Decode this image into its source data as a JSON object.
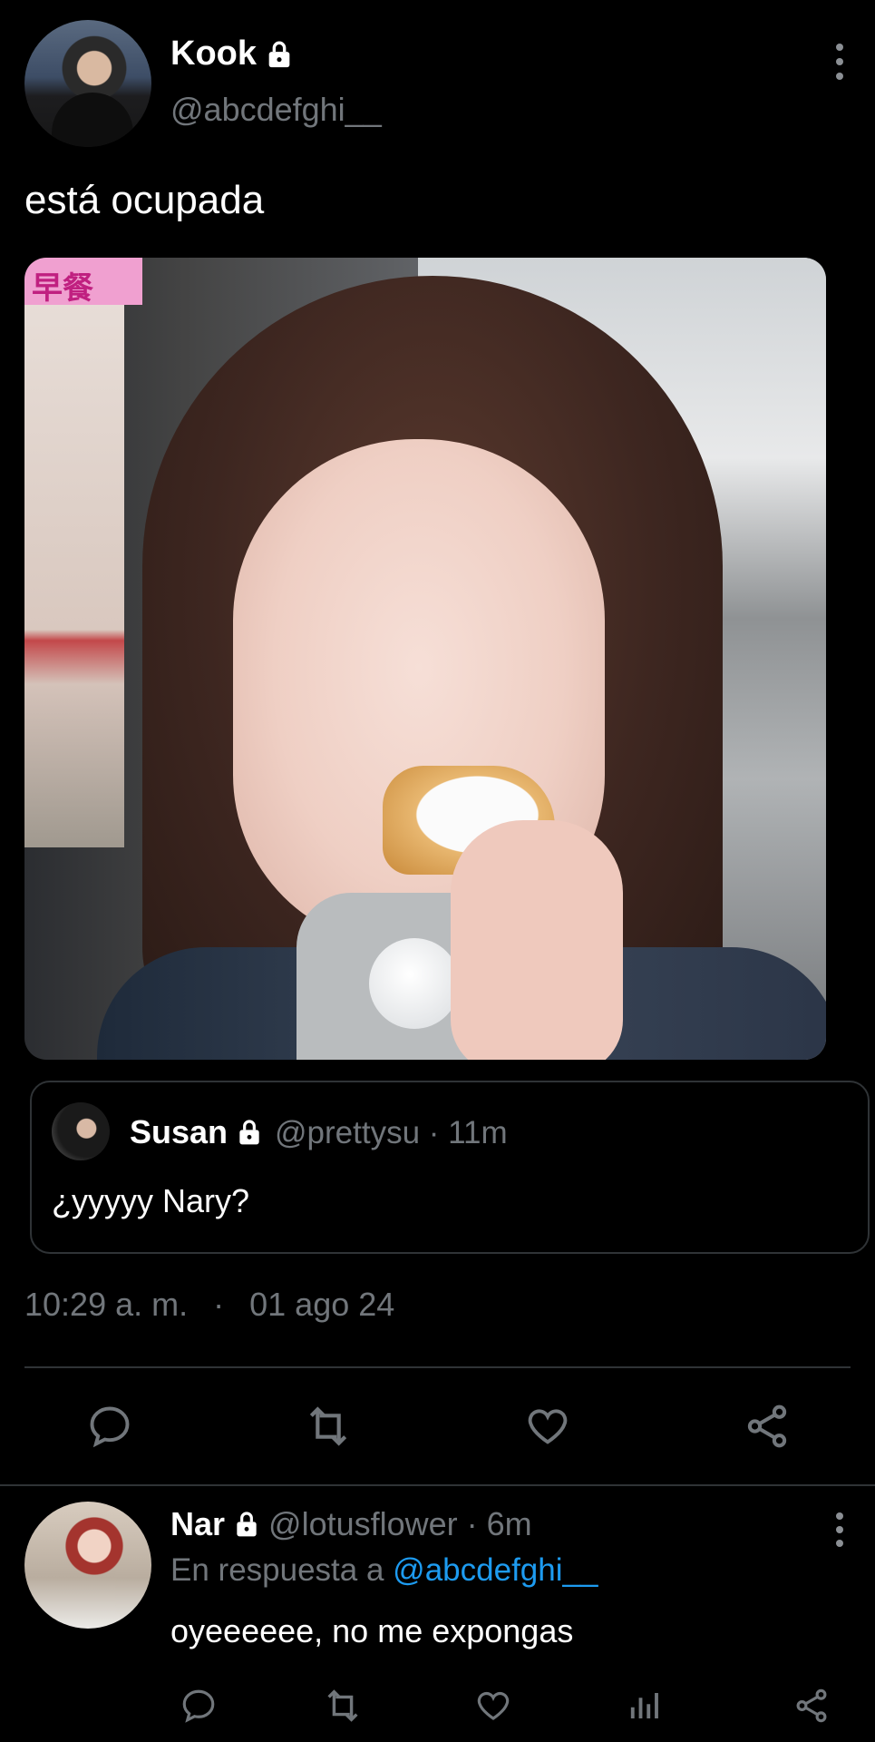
{
  "tweet": {
    "author_name": "Kook",
    "author_handle": "@abcdefghi__",
    "text": "está ocupada",
    "media_caption_tag": "早餐",
    "timestamp": "10:29 a. m.",
    "date_sep": "·",
    "date": "01 ago 24",
    "actions": [
      "reply-icon",
      "retweet-icon",
      "like-icon",
      "share-icon"
    ]
  },
  "quote": {
    "name": "Susan",
    "meta": "@prettysu · 11m",
    "text": "¿yyyyy Nary?"
  },
  "reply": {
    "name": "Nar",
    "meta": "@lotusflower · 6m",
    "reply_prefix": "En respuesta a",
    "reply_handle": "@abcdefghi__",
    "text": "oyeeeeee, no me expongas",
    "actions": [
      "reply-icon",
      "retweet-icon",
      "like-icon",
      "views-icon",
      "share-icon"
    ]
  },
  "colors": {
    "background": "#000000",
    "text": "#e7e9ea",
    "muted": "#71767b",
    "link": "#1d9bf0",
    "border": "#2f3336"
  }
}
